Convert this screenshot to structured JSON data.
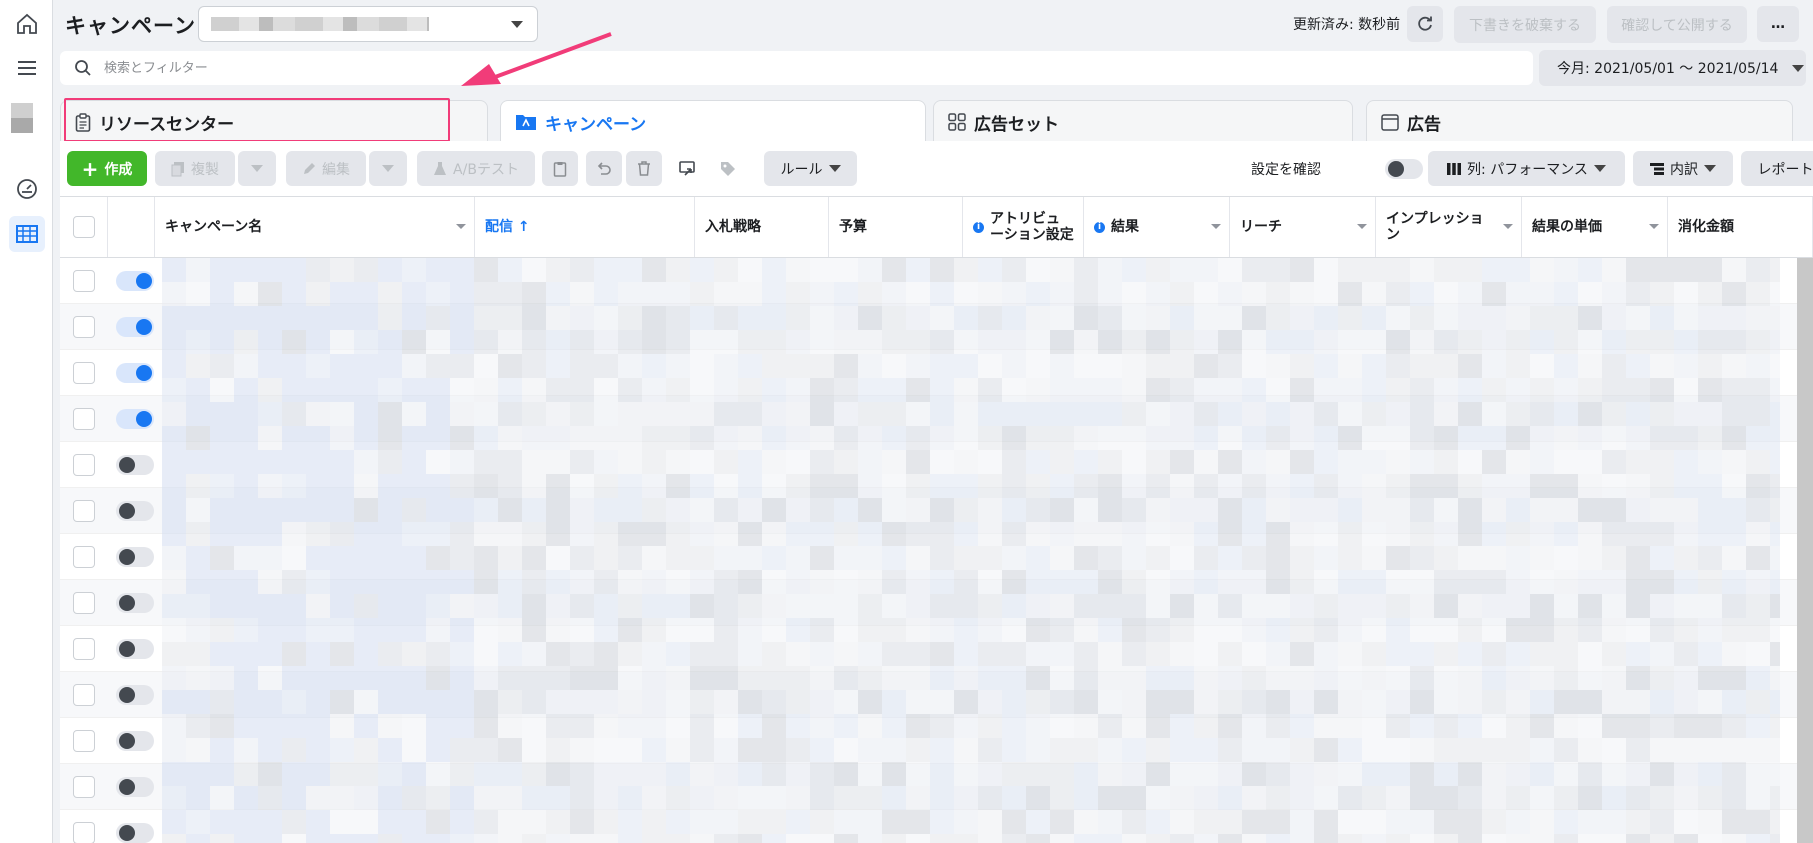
{
  "header": {
    "title": "キャンペーン",
    "updated_status": "更新済み: 数秒前",
    "discard_label": "下書きを破棄する",
    "publish_label": "確認して公開する",
    "more_label": "…"
  },
  "search": {
    "placeholder": "検索とフィルター",
    "date_range": "今月: 2021/05/01 〜 2021/05/14"
  },
  "tabs": [
    {
      "label": "リソースセンター"
    },
    {
      "label": "キャンペーン"
    },
    {
      "label": "広告セット"
    },
    {
      "label": "広告"
    }
  ],
  "toolbar": {
    "create": "作成",
    "duplicate": "複製",
    "edit": "編集",
    "abtest": "A/Bテスト",
    "rules": "ルール",
    "check_settings": "設定を確認",
    "columns": "列: パフォーマンス",
    "breakdown": "内訳",
    "reports": "レポート"
  },
  "table": {
    "columns": [
      {
        "label": "キャンペーン名"
      },
      {
        "label": "配信 ↑"
      },
      {
        "label": "入札戦略"
      },
      {
        "label": "予算"
      },
      {
        "label": "アトリビュ\nーション設定"
      },
      {
        "label": "結果"
      },
      {
        "label": "リーチ"
      },
      {
        "label": "インプレッショ\nン"
      },
      {
        "label": "結果の単価"
      },
      {
        "label": "消化金額"
      }
    ],
    "row_toggles": [
      true,
      true,
      true,
      true,
      false,
      false,
      false,
      false,
      false,
      false,
      false,
      false,
      false
    ]
  },
  "colors": {
    "accent": "#1877f2",
    "create_button": "#42b72a",
    "highlight": "#f13c79"
  }
}
